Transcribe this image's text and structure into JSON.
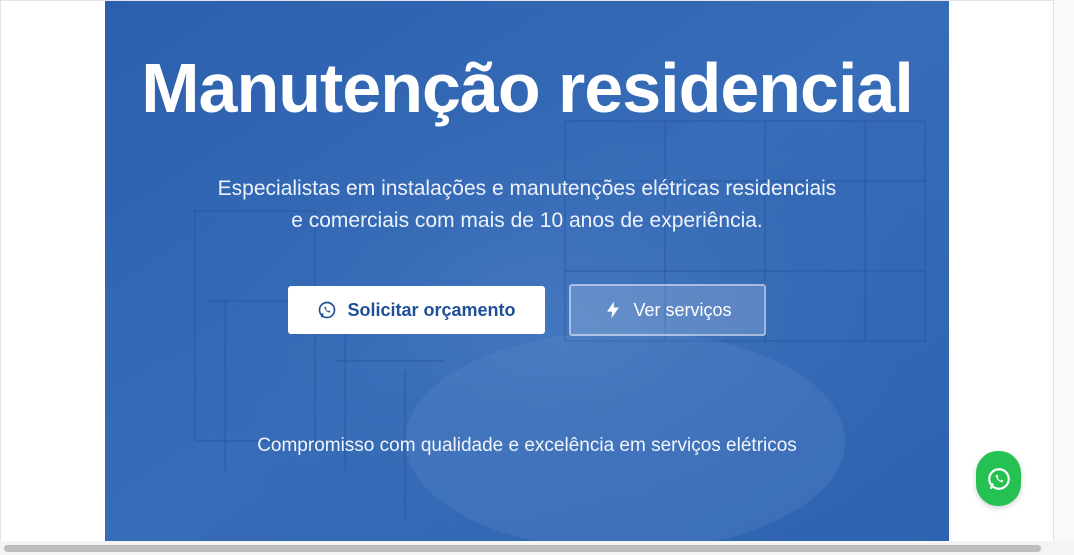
{
  "hero": {
    "title": "Manutenção residencial",
    "subtitle_line1": "Especialistas em instalações e manutenções elétricas residenciais",
    "subtitle_line2": "e comerciais com mais de 10 anos de experiência.",
    "primary_button": {
      "label": "Solicitar orçamento",
      "icon": "whatsapp-icon"
    },
    "secondary_button": {
      "label": "Ver serviços",
      "icon": "lightning-icon"
    },
    "tagline": "Compromisso com qualidade e excelência em serviços elétricos"
  },
  "floating_button": {
    "icon": "whatsapp-icon",
    "color": "#25c152"
  },
  "colors": {
    "hero_overlay": "#2f64b0",
    "primary_button_text": "#1f4f97",
    "text": "#ffffff"
  }
}
